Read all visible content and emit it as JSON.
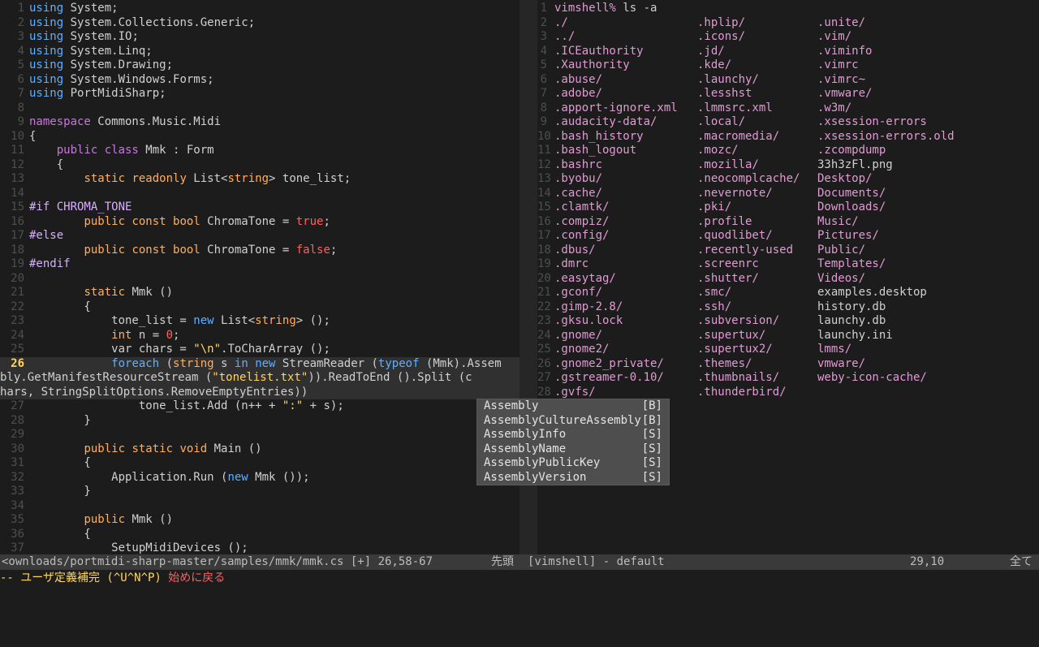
{
  "editor": {
    "lines": [
      {
        "n": "1",
        "segs": [
          [
            "blue",
            "using"
          ],
          [
            "code",
            " System;"
          ]
        ]
      },
      {
        "n": "2",
        "segs": [
          [
            "blue",
            "using"
          ],
          [
            "code",
            " System.Collections.Generic;"
          ]
        ]
      },
      {
        "n": "3",
        "segs": [
          [
            "blue",
            "using"
          ],
          [
            "code",
            " System.IO;"
          ]
        ]
      },
      {
        "n": "4",
        "segs": [
          [
            "blue",
            "using"
          ],
          [
            "code",
            " System.Linq;"
          ]
        ]
      },
      {
        "n": "5",
        "segs": [
          [
            "blue",
            "using"
          ],
          [
            "code",
            " System.Drawing;"
          ]
        ]
      },
      {
        "n": "6",
        "segs": [
          [
            "blue",
            "using"
          ],
          [
            "code",
            " System.Windows.Forms;"
          ]
        ]
      },
      {
        "n": "7",
        "segs": [
          [
            "blue",
            "using"
          ],
          [
            "code",
            " PortMidiSharp;"
          ]
        ]
      },
      {
        "n": "8",
        "segs": []
      },
      {
        "n": "9",
        "segs": [
          [
            "kw",
            "namespace"
          ],
          [
            "code",
            " Commons.Music.Midi"
          ]
        ]
      },
      {
        "n": "10",
        "segs": [
          [
            "code",
            "{"
          ]
        ]
      },
      {
        "n": "11",
        "segs": [
          [
            "code",
            "    "
          ],
          [
            "kw",
            "public class"
          ],
          [
            "code",
            " Mmk : Form"
          ]
        ]
      },
      {
        "n": "12",
        "segs": [
          [
            "code",
            "    {"
          ]
        ]
      },
      {
        "n": "13",
        "segs": [
          [
            "code",
            "        "
          ],
          [
            "type",
            "static readonly"
          ],
          [
            "code",
            " List<"
          ],
          [
            "type",
            "string"
          ],
          [
            "code",
            "> tone_list;"
          ]
        ]
      },
      {
        "n": "14",
        "segs": []
      },
      {
        "n": "15",
        "segs": [
          [
            "pre",
            "#if CHROMA_TONE"
          ]
        ]
      },
      {
        "n": "16",
        "segs": [
          [
            "code",
            "        "
          ],
          [
            "type",
            "public const bool"
          ],
          [
            "code",
            " ChromaTone = "
          ],
          [
            "bool",
            "true"
          ],
          [
            "code",
            ";"
          ]
        ]
      },
      {
        "n": "17",
        "segs": [
          [
            "pre",
            "#else"
          ]
        ]
      },
      {
        "n": "18",
        "segs": [
          [
            "code",
            "        "
          ],
          [
            "type",
            "public const bool"
          ],
          [
            "code",
            " ChromaTone = "
          ],
          [
            "bool",
            "false"
          ],
          [
            "code",
            ";"
          ]
        ]
      },
      {
        "n": "19",
        "segs": [
          [
            "pre",
            "#endif"
          ]
        ]
      },
      {
        "n": "20",
        "segs": []
      },
      {
        "n": "21",
        "segs": [
          [
            "code",
            "        "
          ],
          [
            "type",
            "static"
          ],
          [
            "code",
            " Mmk ()"
          ]
        ]
      },
      {
        "n": "22",
        "segs": [
          [
            "code",
            "        {"
          ]
        ]
      },
      {
        "n": "23",
        "segs": [
          [
            "code",
            "            tone_list = "
          ],
          [
            "blue",
            "new"
          ],
          [
            "code",
            " List<"
          ],
          [
            "type",
            "string"
          ],
          [
            "code",
            "> ();"
          ]
        ]
      },
      {
        "n": "24",
        "segs": [
          [
            "code",
            "            "
          ],
          [
            "type",
            "int"
          ],
          [
            "code",
            " n = "
          ],
          [
            "bool",
            "0"
          ],
          [
            "code",
            ";"
          ]
        ]
      },
      {
        "n": "25",
        "segs": [
          [
            "code",
            "            var chars = "
          ],
          [
            "str",
            "\"\\n\""
          ],
          [
            "code",
            ".ToCharArray ();"
          ]
        ]
      },
      {
        "n": "26",
        "cur": true,
        "segs": [
          [
            "code",
            "            "
          ],
          [
            "blue",
            "foreach"
          ],
          [
            "code",
            " ("
          ],
          [
            "type",
            "string"
          ],
          [
            "code",
            " s "
          ],
          [
            "blue",
            "in new"
          ],
          [
            "code",
            " StreamReader ("
          ],
          [
            "blue",
            "typeof"
          ],
          [
            "code",
            " (Mmk).Assem"
          ]
        ]
      },
      {
        "n": "",
        "cur": true,
        "segs": [
          [
            "code",
            "bly.GetManifestResourceStream ("
          ],
          [
            "str",
            "\"tonelist.txt\""
          ],
          [
            "code",
            ")).ReadToEnd ().Split (c"
          ]
        ]
      },
      {
        "n": "",
        "cur": true,
        "segs": [
          [
            "code",
            "hars, StringSplitOptions.RemoveEmptyEntries))"
          ]
        ]
      },
      {
        "n": "27",
        "segs": [
          [
            "code",
            "                tone_list.Add (n++ + "
          ],
          [
            "str",
            "\":\""
          ],
          [
            "code",
            " + s);"
          ]
        ]
      },
      {
        "n": "28",
        "segs": [
          [
            "code",
            "        }"
          ]
        ]
      },
      {
        "n": "29",
        "segs": []
      },
      {
        "n": "30",
        "segs": [
          [
            "code",
            "        "
          ],
          [
            "type",
            "public static void"
          ],
          [
            "code",
            " Main ()"
          ]
        ]
      },
      {
        "n": "31",
        "segs": [
          [
            "code",
            "        {"
          ]
        ]
      },
      {
        "n": "32",
        "segs": [
          [
            "code",
            "            Application.Run ("
          ],
          [
            "blue",
            "new"
          ],
          [
            "code",
            " Mmk ());"
          ]
        ]
      },
      {
        "n": "33",
        "segs": [
          [
            "code",
            "        }"
          ]
        ]
      },
      {
        "n": "34",
        "segs": []
      },
      {
        "n": "35",
        "segs": [
          [
            "code",
            "        "
          ],
          [
            "type",
            "public"
          ],
          [
            "code",
            " Mmk ()"
          ]
        ]
      },
      {
        "n": "36",
        "segs": [
          [
            "code",
            "        {"
          ]
        ]
      },
      {
        "n": "37",
        "segs": [
          [
            "code",
            "            SetupMidiDevices ();"
          ]
        ]
      }
    ]
  },
  "vimshell": {
    "prompt": "vimshell%",
    "command": " ls -a",
    "columns": [
      [
        [
          "dir",
          "./"
        ],
        [
          "dir",
          "../"
        ],
        [
          "dir",
          ".ICEauthority"
        ],
        [
          "dir",
          ".Xauthority"
        ],
        [
          "dir",
          ".abuse/"
        ],
        [
          "dir",
          ".adobe/"
        ],
        [
          "dir",
          ".apport-ignore.xml"
        ],
        [
          "dir",
          ".audacity-data/"
        ],
        [
          "dir",
          ".bash_history"
        ],
        [
          "dir",
          ".bash_logout"
        ],
        [
          "dir",
          ".bashrc"
        ],
        [
          "dir",
          ".byobu/"
        ],
        [
          "dir",
          ".cache/"
        ],
        [
          "dir",
          ".clamtk/"
        ],
        [
          "dir",
          ".compiz/"
        ],
        [
          "dir",
          ".config/"
        ],
        [
          "dir",
          ".dbus/"
        ],
        [
          "dir",
          ".dmrc"
        ],
        [
          "dir",
          ".easytag/"
        ],
        [
          "dir",
          ".gconf/"
        ],
        [
          "dir",
          ".gimp-2.8/"
        ],
        [
          "dir",
          ".gksu.lock"
        ],
        [
          "dir",
          ".gnome/"
        ],
        [
          "dir",
          ".gnome2/"
        ],
        [
          "dir",
          ".gnome2_private/"
        ],
        [
          "dir",
          ".gstreamer-0.10/"
        ],
        [
          "dir",
          ".gvfs/"
        ]
      ],
      [
        [
          "dir",
          ".hplip/"
        ],
        [
          "dir",
          ".icons/"
        ],
        [
          "dir",
          ".jd/"
        ],
        [
          "dir",
          ".kde/"
        ],
        [
          "dir",
          ".launchy/"
        ],
        [
          "dir",
          ".lesshst"
        ],
        [
          "dir",
          ".lmmsrc.xml"
        ],
        [
          "dir",
          ".local/"
        ],
        [
          "dir",
          ".macromedia/"
        ],
        [
          "dir",
          ".mozc/"
        ],
        [
          "dir",
          ".mozilla/"
        ],
        [
          "dir",
          ".neocomplcache/"
        ],
        [
          "dir",
          ".nevernote/"
        ],
        [
          "dir",
          ".pki/"
        ],
        [
          "dir",
          ".profile"
        ],
        [
          "dir",
          ".quodlibet/"
        ],
        [
          "dir",
          ".recently-used"
        ],
        [
          "dir",
          ".screenrc"
        ],
        [
          "dir",
          ".shutter/"
        ],
        [
          "dir",
          ".smc/"
        ],
        [
          "dir",
          ".ssh/"
        ],
        [
          "dir",
          ".subversion/"
        ],
        [
          "dir",
          ".supertux/"
        ],
        [
          "dir",
          ".supertux2/"
        ],
        [
          "dir",
          ".themes/"
        ],
        [
          "dir",
          ".thumbnails/"
        ],
        [
          "dir",
          ".thunderbird/"
        ]
      ],
      [
        [
          "dir",
          ".unite/"
        ],
        [
          "dir",
          ".vim/"
        ],
        [
          "dir",
          ".viminfo"
        ],
        [
          "dir",
          ".vimrc"
        ],
        [
          "dir",
          ".vimrc~"
        ],
        [
          "dir",
          ".vmware/"
        ],
        [
          "dir",
          ".w3m/"
        ],
        [
          "dir",
          ".xsession-errors"
        ],
        [
          "dir",
          ".xsession-errors.old"
        ],
        [
          "dir",
          ".zcompdump"
        ],
        [
          "file",
          "33h3zFl.png"
        ],
        [
          "dir",
          "Desktop/"
        ],
        [
          "dir",
          "Documents/"
        ],
        [
          "dir",
          "Downloads/"
        ],
        [
          "dir",
          "Music/"
        ],
        [
          "dir",
          "Pictures/"
        ],
        [
          "dir",
          "Public/"
        ],
        [
          "dir",
          "Templates/"
        ],
        [
          "dir",
          "Videos/"
        ],
        [
          "file",
          "examples.desktop"
        ],
        [
          "file",
          "history.db"
        ],
        [
          "file",
          "launchy.db"
        ],
        [
          "file",
          "launchy.ini"
        ],
        [
          "dir",
          "lmms/"
        ],
        [
          "dir",
          "vmware/"
        ],
        [
          "dir",
          "weby-icon-cache/"
        ]
      ]
    ],
    "line_count": 29,
    "tilde": "~",
    "tilde_lines": 10
  },
  "completion_popup": {
    "items": [
      {
        "word": "Assembly",
        "kind": "[B]"
      },
      {
        "word": "AssemblyCultureAssembly",
        "kind": "[B]"
      },
      {
        "word": "AssemblyInfo",
        "kind": "[S]"
      },
      {
        "word": "AssemblyName",
        "kind": "[S]"
      },
      {
        "word": "AssemblyPublicKey",
        "kind": "[S]"
      },
      {
        "word": "AssemblyVersion",
        "kind": "[S]"
      }
    ]
  },
  "statusbar": {
    "left_file": "<ownloads/portmidi-sharp-master/samples/mmk/mmk.cs [+] 26,58-67",
    "left_pos": "先頭",
    "right_name": "[vimshell] - default",
    "right_cursor": "29,10",
    "right_pos": "全て"
  },
  "cmdline": {
    "mode": "-- ユーザ定義補完 (^U^N^P) ",
    "back": "始めに戻る"
  },
  "colors": {
    "background": "#1c1c1c",
    "keyword": "#c678dd",
    "type": "#ffaf5f",
    "string": "#ffd75f",
    "boolean": "#ff5f5f",
    "directory": "#e09bd2",
    "popup_bg": "#4e4e4e"
  }
}
